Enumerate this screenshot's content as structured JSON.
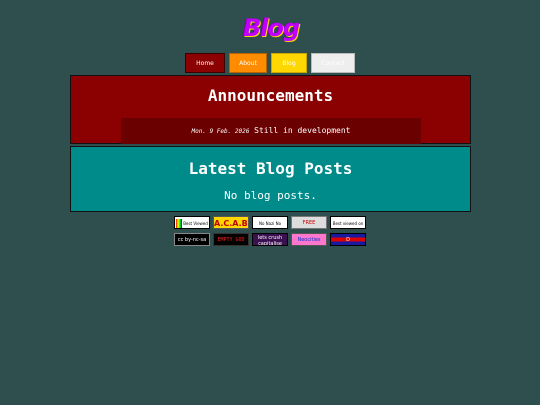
{
  "logo": {
    "text": "Blog"
  },
  "nav": {
    "home": "Home",
    "about": "About",
    "blog": "Blog",
    "contact": "Contact"
  },
  "announcements": {
    "heading": "Announcements",
    "items": [
      {
        "date": "Mon. 9 Feb. 2026",
        "text": "Still in development"
      }
    ]
  },
  "blog_posts": {
    "heading": "Latest Blog Posts",
    "empty_text": "No blog posts."
  },
  "badges": [
    {
      "name": "best-viewed-badge",
      "text": "Best Viewed 800 x 600"
    },
    {
      "name": "acab-badge",
      "text": "A.C.A.B."
    },
    {
      "name": "no-nazi-badge",
      "text": "No Nazi No Fascists"
    },
    {
      "name": "palestine-badge",
      "text": "FREE PALESTINE"
    },
    {
      "name": "best-viewed-desktop-badge",
      "text": "Best viewed on desktop"
    },
    {
      "name": "creative-commons-badge",
      "text": "cc by-nc-sa"
    },
    {
      "name": "empty-badge",
      "text": "EMPTY GOD"
    },
    {
      "name": "crush-capitalism-badge",
      "text": "lets crush capitalise"
    },
    {
      "name": "neocities-badge",
      "text": "Neocities"
    },
    {
      "name": "flag-badge",
      "text": "D"
    }
  ]
}
